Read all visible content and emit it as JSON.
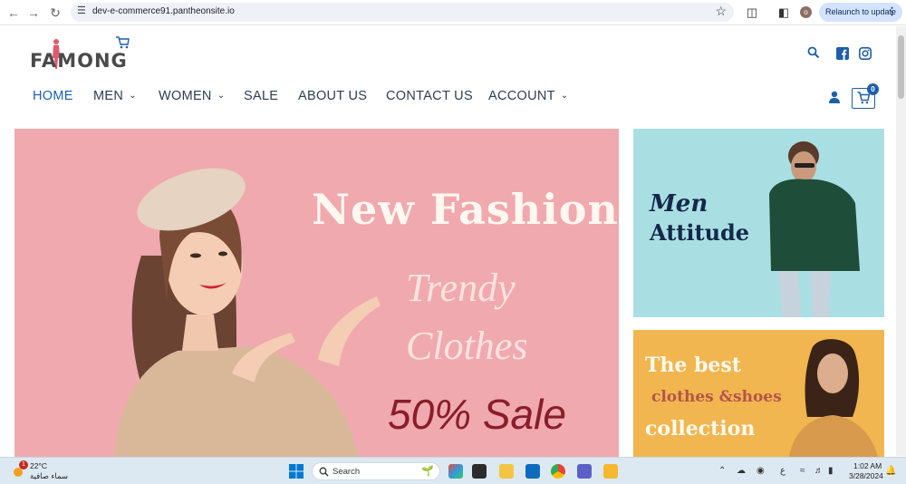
{
  "browser": {
    "url": "dev-e-commerce91.pantheonsite.io",
    "profile_initial": "o",
    "relaunch_label": "Relaunch to update"
  },
  "site": {
    "logo_text": "FAMONG",
    "nav": [
      "HOME",
      "MEN",
      "WOMEN",
      "SALE",
      "ABOUT US",
      "CONTACT US",
      "ACCOUNT"
    ],
    "cart_count": "0"
  },
  "hero": {
    "title": "New  Fashion",
    "line1": "Trendy",
    "line2": "Clothes",
    "sale": "50% Sale"
  },
  "banner_men": {
    "line1": "Men",
    "line2": "Attitude"
  },
  "banner_collection": {
    "line1": "The  best",
    "line2": "clothes &shoes",
    "line3": "collection"
  },
  "taskbar": {
    "weather_temp": "22°C",
    "weather_desc": "سماء صافية",
    "weather_badge": "1",
    "search_label": "Search",
    "lang": "ع",
    "time": "1:02 AM",
    "date": "3/28/2024"
  },
  "colors": {
    "accent": "#1e5fa8",
    "hero_bg": "#f0a9ae",
    "men_bg": "#a9dfe2",
    "collection_bg": "#f1b64f"
  }
}
